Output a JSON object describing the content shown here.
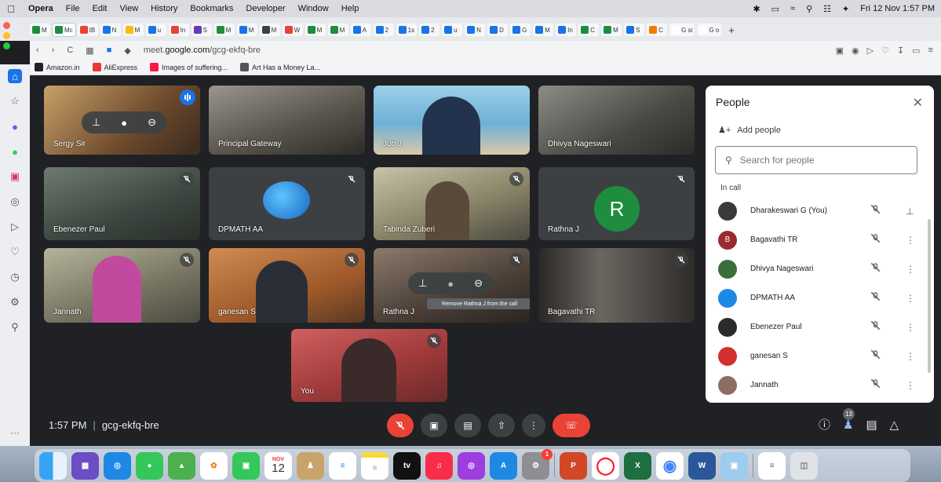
{
  "menubar": {
    "app": "Opera",
    "items": [
      "File",
      "Edit",
      "View",
      "History",
      "Bookmarks",
      "Developer",
      "Window",
      "Help"
    ],
    "clock": "Fri 12 Nov  1:57 PM"
  },
  "browser": {
    "tabs": [
      {
        "label": "M",
        "color": "#1e8e3e"
      },
      {
        "label": "Mc",
        "color": "#1e8e3e",
        "active": true
      },
      {
        "label": "IB",
        "color": "#ea4335"
      },
      {
        "label": "N",
        "color": "#1a73e8"
      },
      {
        "label": "M",
        "color": "#fbbc04"
      },
      {
        "label": "u",
        "color": "#1a73e8"
      },
      {
        "label": "In",
        "color": "#ea4335"
      },
      {
        "label": "S",
        "color": "#673ab7"
      },
      {
        "label": "M",
        "color": "#1e8e3e"
      },
      {
        "label": "M",
        "color": "#1a73e8"
      },
      {
        "label": "M",
        "color": "#3c4043"
      },
      {
        "label": "W",
        "color": "#ea4335"
      },
      {
        "label": "M",
        "color": "#1e8e3e"
      },
      {
        "label": "M",
        "color": "#1e8e3e"
      },
      {
        "label": "A",
        "color": "#1a73e8"
      },
      {
        "label": "2",
        "color": "#1a73e8"
      },
      {
        "label": "1s",
        "color": "#1a73e8"
      },
      {
        "label": "2",
        "color": "#1a73e8"
      },
      {
        "label": "u",
        "color": "#1a73e8"
      },
      {
        "label": "N",
        "color": "#1a73e8"
      },
      {
        "label": "D",
        "color": "#1a73e8"
      },
      {
        "label": "G",
        "color": "#1a73e8"
      },
      {
        "label": "M",
        "color": "#1a73e8"
      },
      {
        "label": "In",
        "color": "#1a73e8"
      },
      {
        "label": "C",
        "color": "#1e8e3e"
      },
      {
        "label": "M",
        "color": "#1e8e3e"
      },
      {
        "label": "S",
        "color": "#1a73e8"
      },
      {
        "label": "C",
        "color": "#f57c00"
      },
      {
        "label": "G si",
        "color": "#ffffff"
      },
      {
        "label": "G o",
        "color": "#ffffff"
      }
    ],
    "tab_plus": "+",
    "url_prefix": "meet.",
    "url_host": "google.com",
    "url_path": "/gcg-ekfq-bre",
    "bookmarks": [
      {
        "label": "Amazon.in",
        "color": "#222222"
      },
      {
        "label": "AliExpress",
        "color": "#e53935"
      },
      {
        "label": "Images of suffering...",
        "color": "#ff1744"
      },
      {
        "label": "Art Has a Money La...",
        "color": "#555555"
      }
    ]
  },
  "meet": {
    "time": "1:57 PM",
    "code": "gcg-ekfq-bre",
    "participant_count": "13",
    "tiles": [
      {
        "name": "Sergy Sir",
        "bg": "#8a6a4a"
      },
      {
        "name": "Principal Gateway",
        "bg": "#6e6a62"
      },
      {
        "name": "Job J",
        "bg": "#7fb8d8"
      },
      {
        "name": "Dhivya Nageswari",
        "bg": "#5a5752"
      },
      {
        "name": "Ebenezer Paul",
        "bg": "#4e5a52"
      },
      {
        "name": "DPMATH AA",
        "bg": "#3c4043"
      },
      {
        "name": "Tabinda Zuberi",
        "bg": "#7d7a6a"
      },
      {
        "name": "Rathna J",
        "bg": "#3c4043"
      },
      {
        "name": "Jannath",
        "bg": "#8a8a72"
      },
      {
        "name": "ganesan S",
        "bg": "#b06a3a"
      },
      {
        "name": "Rathna J",
        "bg": "#4a4240"
      },
      {
        "name": "Bagavathi TR",
        "bg": "#3a3835"
      },
      {
        "name": "You",
        "bg": "#b04848"
      }
    ],
    "avatar_letter": "R",
    "tooltip": "Remove Rathna J from the call"
  },
  "people": {
    "title": "People",
    "add_label": "Add people",
    "search_placeholder": "Search for people",
    "section": "In call",
    "list": [
      {
        "name": "Dharakeswari G (You)",
        "color": "#3a3a3a",
        "initial": ""
      },
      {
        "name": "Bagavathi TR",
        "color": "#9c2b2b",
        "initial": "B"
      },
      {
        "name": "Dhivya Nageswari",
        "color": "#3b6e3b",
        "initial": ""
      },
      {
        "name": "DPMATH AA",
        "color": "#1e88e5",
        "initial": ""
      },
      {
        "name": "Ebenezer Paul",
        "color": "#2b2b2b",
        "initial": ""
      },
      {
        "name": "ganesan S",
        "color": "#d32f2f",
        "initial": ""
      },
      {
        "name": "Jannath",
        "color": "#8d6e63",
        "initial": ""
      }
    ]
  },
  "dock": {
    "calendar_month": "NOV",
    "calendar_day": "12",
    "tv_label": "tv",
    "badge": "1"
  }
}
